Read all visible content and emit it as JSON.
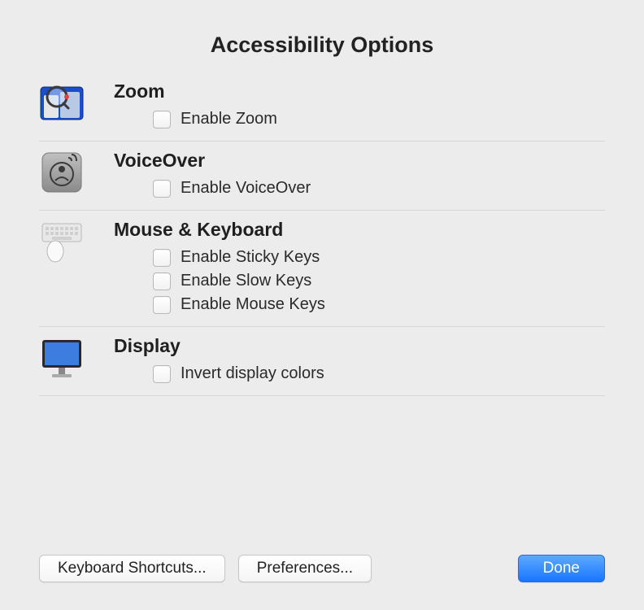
{
  "title": "Accessibility Options",
  "sections": {
    "zoom": {
      "title": "Zoom",
      "options": {
        "enable": "Enable Zoom"
      }
    },
    "voiceover": {
      "title": "VoiceOver",
      "options": {
        "enable": "Enable VoiceOver"
      }
    },
    "mousekeyboard": {
      "title": "Mouse & Keyboard",
      "options": {
        "sticky": "Enable Sticky Keys",
        "slow": "Enable Slow Keys",
        "mouse": "Enable Mouse Keys"
      }
    },
    "display": {
      "title": "Display",
      "options": {
        "invert": "Invert display colors"
      }
    }
  },
  "footer": {
    "keyboard_shortcuts": "Keyboard Shortcuts...",
    "preferences": "Preferences...",
    "done": "Done"
  }
}
